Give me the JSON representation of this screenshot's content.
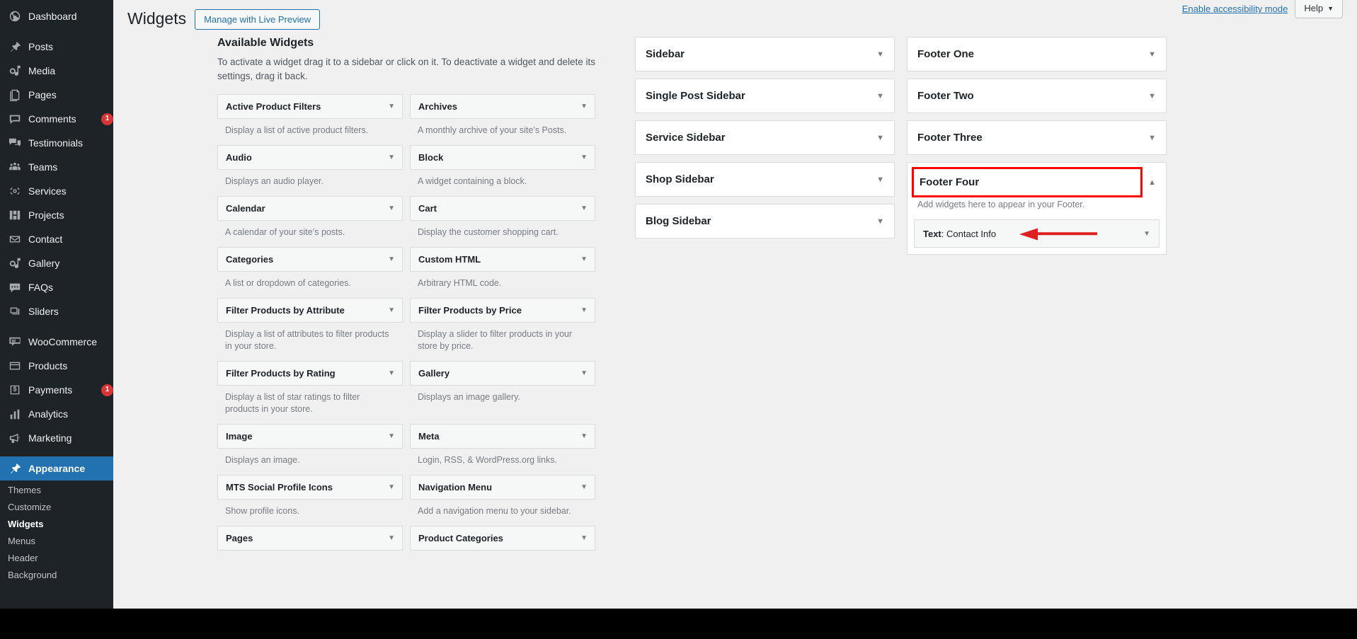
{
  "admin_menu": {
    "items": [
      {
        "label": "Dashboard",
        "icon": "dashboard-icon",
        "badge": null,
        "current": false
      },
      {
        "label": "Posts",
        "icon": "pin-icon",
        "badge": null,
        "current": false,
        "sep_before": true
      },
      {
        "label": "Media",
        "icon": "media-icon",
        "badge": null,
        "current": false
      },
      {
        "label": "Pages",
        "icon": "pages-icon",
        "badge": null,
        "current": false
      },
      {
        "label": "Comments",
        "icon": "comments-icon",
        "badge": "1",
        "current": false
      },
      {
        "label": "Testimonials",
        "icon": "testimonials-icon",
        "badge": null,
        "current": false
      },
      {
        "label": "Teams",
        "icon": "teams-icon",
        "badge": null,
        "current": false
      },
      {
        "label": "Services",
        "icon": "services-icon",
        "badge": null,
        "current": false
      },
      {
        "label": "Projects",
        "icon": "projects-icon",
        "badge": null,
        "current": false
      },
      {
        "label": "Contact",
        "icon": "envelope-icon",
        "badge": null,
        "current": false
      },
      {
        "label": "Gallery",
        "icon": "gallery-icon",
        "badge": null,
        "current": false
      },
      {
        "label": "FAQs",
        "icon": "faq-icon",
        "badge": null,
        "current": false
      },
      {
        "label": "Sliders",
        "icon": "sliders-icon",
        "badge": null,
        "current": false
      },
      {
        "label": "WooCommerce",
        "icon": "woocommerce-icon",
        "badge": null,
        "current": false,
        "sep_before": true
      },
      {
        "label": "Products",
        "icon": "products-icon",
        "badge": null,
        "current": false
      },
      {
        "label": "Payments",
        "icon": "payments-icon",
        "badge": "1",
        "current": false
      },
      {
        "label": "Analytics",
        "icon": "analytics-icon",
        "badge": null,
        "current": false
      },
      {
        "label": "Marketing",
        "icon": "marketing-icon",
        "badge": null,
        "current": false
      },
      {
        "label": "Appearance",
        "icon": "appearance-icon",
        "badge": null,
        "current": true,
        "sep_before": true
      }
    ],
    "appearance_submenu": [
      {
        "label": "Themes",
        "current": false
      },
      {
        "label": "Customize",
        "current": false
      },
      {
        "label": "Widgets",
        "current": true
      },
      {
        "label": "Menus",
        "current": false
      },
      {
        "label": "Header",
        "current": false
      },
      {
        "label": "Background",
        "current": false
      }
    ]
  },
  "screen_meta": {
    "accessibility_link": "Enable accessibility mode",
    "help_label": "Help",
    "help_caret": "▼"
  },
  "page": {
    "title": "Widgets",
    "live_preview_button": "Manage with Live Preview"
  },
  "available_widgets": {
    "heading": "Available Widgets",
    "description": "To activate a widget drag it to a sidebar or click on it. To deactivate a widget and delete its settings, drag it back.",
    "caret": "▼",
    "items": [
      {
        "title": "Active Product Filters",
        "desc": "Display a list of active product filters."
      },
      {
        "title": "Archives",
        "desc": "A monthly archive of your site’s Posts."
      },
      {
        "title": "Audio",
        "desc": "Displays an audio player."
      },
      {
        "title": "Block",
        "desc": "A widget containing a block."
      },
      {
        "title": "Calendar",
        "desc": "A calendar of your site’s posts."
      },
      {
        "title": "Cart",
        "desc": "Display the customer shopping cart."
      },
      {
        "title": "Categories",
        "desc": "A list or dropdown of categories."
      },
      {
        "title": "Custom HTML",
        "desc": "Arbitrary HTML code."
      },
      {
        "title": "Filter Products by Attribute",
        "desc": "Display a list of attributes to filter products in your store."
      },
      {
        "title": "Filter Products by Price",
        "desc": "Display a slider to filter products in your store by price."
      },
      {
        "title": "Filter Products by Rating",
        "desc": "Display a list of star ratings to filter products in your store."
      },
      {
        "title": "Gallery",
        "desc": "Displays an image gallery."
      },
      {
        "title": "Image",
        "desc": "Displays an image."
      },
      {
        "title": "Meta",
        "desc": "Login, RSS, & WordPress.org links."
      },
      {
        "title": "MTS Social Profile Icons",
        "desc": "Show profile icons."
      },
      {
        "title": "Navigation Menu",
        "desc": "Add a navigation menu to your sidebar."
      },
      {
        "title": "Pages",
        "desc": ""
      },
      {
        "title": "Product Categories",
        "desc": ""
      }
    ]
  },
  "sidebars": {
    "caret_closed": "▼",
    "caret_open": "▲",
    "column_one": [
      {
        "name": "Sidebar",
        "open": false
      },
      {
        "name": "Single Post Sidebar",
        "open": false
      },
      {
        "name": "Service Sidebar",
        "open": false
      },
      {
        "name": "Shop Sidebar",
        "open": false
      },
      {
        "name": "Blog Sidebar",
        "open": false
      }
    ],
    "column_two": [
      {
        "name": "Footer One",
        "open": false
      },
      {
        "name": "Footer Two",
        "open": false
      },
      {
        "name": "Footer Three",
        "open": false
      }
    ],
    "footer_four": {
      "name": "Footer Four",
      "description": "Add widgets here to appear in your Footer.",
      "highlight_color": "#ff0000",
      "widget_type": "Text",
      "widget_separator": ": ",
      "widget_title": "Contact Info",
      "caret": "▼"
    }
  },
  "annotation": {
    "arrow_color": "#e02020"
  }
}
